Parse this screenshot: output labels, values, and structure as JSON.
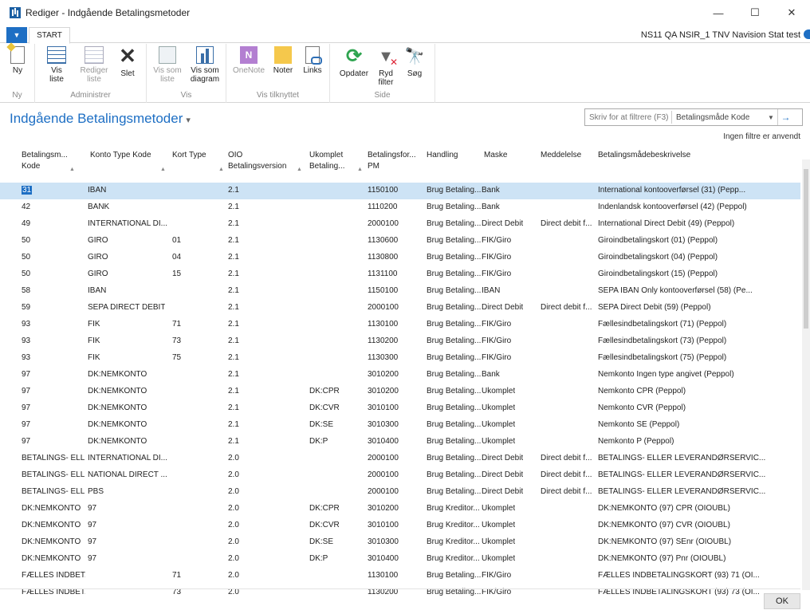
{
  "window": {
    "title": "Rediger - Indgående Betalingsmetoder",
    "buttons": {
      "minimize": "—",
      "maximize": "☐",
      "close": "✕"
    }
  },
  "ribbon": {
    "file_tab": "▼",
    "start_tab": "START",
    "company": "NS11 QA NSIR_1 TNV Navision Stat test",
    "groups": {
      "ny": {
        "label": "Ny",
        "buttons": {
          "ny": "Ny"
        }
      },
      "administrer": {
        "label": "Administrer",
        "buttons": {
          "vis_liste": "Vis liste",
          "rediger_liste": "Rediger liste",
          "slet": "Slet"
        }
      },
      "vis": {
        "label": "Vis",
        "buttons": {
          "vis_som_liste": "Vis som liste",
          "vis_som_diagram": "Vis som diagram"
        }
      },
      "vis_tilknyttet": {
        "label": "Vis tilknyttet",
        "buttons": {
          "onenote": "OneNote",
          "noter": "Noter",
          "links": "Links"
        }
      },
      "side": {
        "label": "Side",
        "buttons": {
          "opdater": "Opdater",
          "ryd_filter": "Ryd filter",
          "sog": "Søg"
        }
      }
    }
  },
  "page": {
    "title": "Indgående Betalingsmetoder",
    "title_chevron": "▾",
    "filter": {
      "placeholder": "Skriv for at filtrere (F3)",
      "field": "Betalingsmåde Kode",
      "dropdown": "▼",
      "go": "→"
    },
    "no_filters": "Ingen filtre er anvendt"
  },
  "table": {
    "headers": {
      "kode": [
        "Betalingsm...",
        "Kode"
      ],
      "konto": "Konto Type Kode",
      "kort": "Kort Type",
      "oio": [
        "OIO",
        "Betalingsversion"
      ],
      "ukomplet": [
        "Ukomplet",
        "Betaling..."
      ],
      "pm": [
        "Betalingsfor...",
        "PM"
      ],
      "handling": "Handling",
      "maske": "Maske",
      "meddelelse": "Meddelelse",
      "beskrivelse": "Betalingsmådebeskrivelse"
    },
    "rows": [
      {
        "kode": "31",
        "konto": "IBAN",
        "kort": "",
        "oio": "2.1",
        "ukomplet": "",
        "pm": "1150100",
        "handling": "Brug Betaling...",
        "maske": "Bank",
        "meddelelse": "",
        "beskrivelse": "International kontooverførsel (31) (Pepp..."
      },
      {
        "kode": "42",
        "konto": "BANK",
        "kort": "",
        "oio": "2.1",
        "ukomplet": "",
        "pm": "1110200",
        "handling": "Brug Betaling...",
        "maske": "Bank",
        "meddelelse": "",
        "beskrivelse": "Indenlandsk kontooverførsel (42) (Peppol)"
      },
      {
        "kode": "49",
        "konto": "INTERNATIONAL DI...",
        "kort": "",
        "oio": "2.1",
        "ukomplet": "",
        "pm": "2000100",
        "handling": "Brug Betaling...",
        "maske": "Direct Debit",
        "meddelelse": "Direct debit f...",
        "beskrivelse": "International Direct Debit (49) (Peppol)"
      },
      {
        "kode": "50",
        "konto": "GIRO",
        "kort": "01",
        "oio": "2.1",
        "ukomplet": "",
        "pm": "1130600",
        "handling": "Brug Betaling...",
        "maske": "FIK/Giro",
        "meddelelse": "",
        "beskrivelse": "Giroindbetalingskort (01) (Peppol)"
      },
      {
        "kode": "50",
        "konto": "GIRO",
        "kort": "04",
        "oio": "2.1",
        "ukomplet": "",
        "pm": "1130800",
        "handling": "Brug Betaling...",
        "maske": "FIK/Giro",
        "meddelelse": "",
        "beskrivelse": "Giroindbetalingskort (04) (Peppol)"
      },
      {
        "kode": "50",
        "konto": "GIRO",
        "kort": "15",
        "oio": "2.1",
        "ukomplet": "",
        "pm": "1131100",
        "handling": "Brug Betaling...",
        "maske": "FIK/Giro",
        "meddelelse": "",
        "beskrivelse": "Giroindbetalingskort (15) (Peppol)"
      },
      {
        "kode": "58",
        "konto": "IBAN",
        "kort": "",
        "oio": "2.1",
        "ukomplet": "",
        "pm": "1150100",
        "handling": "Brug Betaling...",
        "maske": "IBAN",
        "meddelelse": "",
        "beskrivelse": "SEPA IBAN Only kontooverførsel (58) (Pe..."
      },
      {
        "kode": "59",
        "konto": "SEPA DIRECT DEBIT",
        "kort": "",
        "oio": "2.1",
        "ukomplet": "",
        "pm": "2000100",
        "handling": "Brug Betaling...",
        "maske": "Direct Debit",
        "meddelelse": "Direct debit f...",
        "beskrivelse": "SEPA Direct Debit (59) (Peppol)"
      },
      {
        "kode": "93",
        "konto": "FIK",
        "kort": "71",
        "oio": "2.1",
        "ukomplet": "",
        "pm": "1130100",
        "handling": "Brug Betaling...",
        "maske": "FIK/Giro",
        "meddelelse": "",
        "beskrivelse": "Fællesindbetalingskort (71) (Peppol)"
      },
      {
        "kode": "93",
        "konto": "FIK",
        "kort": "73",
        "oio": "2.1",
        "ukomplet": "",
        "pm": "1130200",
        "handling": "Brug Betaling...",
        "maske": "FIK/Giro",
        "meddelelse": "",
        "beskrivelse": "Fællesindbetalingskort (73) (Peppol)"
      },
      {
        "kode": "93",
        "konto": "FIK",
        "kort": "75",
        "oio": "2.1",
        "ukomplet": "",
        "pm": "1130300",
        "handling": "Brug Betaling...",
        "maske": "FIK/Giro",
        "meddelelse": "",
        "beskrivelse": "Fællesindbetalingskort (75) (Peppol)"
      },
      {
        "kode": "97",
        "konto": "DK:NEMKONTO",
        "kort": "",
        "oio": "2.1",
        "ukomplet": "",
        "pm": "3010200",
        "handling": "Brug Betaling...",
        "maske": "Bank",
        "meddelelse": "",
        "beskrivelse": "Nemkonto Ingen type angivet (Peppol)"
      },
      {
        "kode": "97",
        "konto": "DK:NEMKONTO",
        "kort": "",
        "oio": "2.1",
        "ukomplet": "DK:CPR",
        "pm": "3010200",
        "handling": "Brug Betaling...",
        "maske": "Ukomplet",
        "meddelelse": "",
        "beskrivelse": "Nemkonto CPR (Peppol)"
      },
      {
        "kode": "97",
        "konto": "DK:NEMKONTO",
        "kort": "",
        "oio": "2.1",
        "ukomplet": "DK:CVR",
        "pm": "3010100",
        "handling": "Brug Betaling...",
        "maske": "Ukomplet",
        "meddelelse": "",
        "beskrivelse": "Nemkonto CVR (Peppol)"
      },
      {
        "kode": "97",
        "konto": "DK:NEMKONTO",
        "kort": "",
        "oio": "2.1",
        "ukomplet": "DK:SE",
        "pm": "3010300",
        "handling": "Brug Betaling...",
        "maske": "Ukomplet",
        "meddelelse": "",
        "beskrivelse": "Nemkonto SE (Peppol)"
      },
      {
        "kode": "97",
        "konto": "DK:NEMKONTO",
        "kort": "",
        "oio": "2.1",
        "ukomplet": "DK:P",
        "pm": "3010400",
        "handling": "Brug Betaling...",
        "maske": "Ukomplet",
        "meddelelse": "",
        "beskrivelse": "Nemkonto P (Peppol)"
      },
      {
        "kode": "BETALINGS- ELL...",
        "konto": "INTERNATIONAL DI...",
        "kort": "",
        "oio": "2.0",
        "ukomplet": "",
        "pm": "2000100",
        "handling": "Brug Betaling...",
        "maske": "Direct Debit",
        "meddelelse": "Direct debit f...",
        "beskrivelse": "BETALINGS- ELLER LEVERANDØRSERVIC..."
      },
      {
        "kode": "BETALINGS- ELL...",
        "konto": "NATIONAL DIRECT ...",
        "kort": "",
        "oio": "2.0",
        "ukomplet": "",
        "pm": "2000100",
        "handling": "Brug Betaling...",
        "maske": "Direct Debit",
        "meddelelse": "Direct debit f...",
        "beskrivelse": "BETALINGS- ELLER LEVERANDØRSERVIC..."
      },
      {
        "kode": "BETALINGS- ELL...",
        "konto": "PBS",
        "kort": "",
        "oio": "2.0",
        "ukomplet": "",
        "pm": "2000100",
        "handling": "Brug Betaling...",
        "maske": "Direct Debit",
        "meddelelse": "Direct debit f...",
        "beskrivelse": "BETALINGS- ELLER LEVERANDØRSERVIC..."
      },
      {
        "kode": "DK:NEMKONTO",
        "konto": "97",
        "kort": "",
        "oio": "2.0",
        "ukomplet": "DK:CPR",
        "pm": "3010200",
        "handling": "Brug Kreditor...",
        "maske": "Ukomplet",
        "meddelelse": "",
        "beskrivelse": "DK:NEMKONTO (97) CPR (OIOUBL)"
      },
      {
        "kode": "DK:NEMKONTO",
        "konto": "97",
        "kort": "",
        "oio": "2.0",
        "ukomplet": "DK:CVR",
        "pm": "3010100",
        "handling": "Brug Kreditor...",
        "maske": "Ukomplet",
        "meddelelse": "",
        "beskrivelse": "DK:NEMKONTO (97) CVR (OIOUBL)"
      },
      {
        "kode": "DK:NEMKONTO",
        "konto": "97",
        "kort": "",
        "oio": "2.0",
        "ukomplet": "DK:SE",
        "pm": "3010300",
        "handling": "Brug Kreditor...",
        "maske": "Ukomplet",
        "meddelelse": "",
        "beskrivelse": "DK:NEMKONTO (97) SEnr (OIOUBL)"
      },
      {
        "kode": "DK:NEMKONTO",
        "konto": "97",
        "kort": "",
        "oio": "2.0",
        "ukomplet": "DK:P",
        "pm": "3010400",
        "handling": "Brug Kreditor...",
        "maske": "Ukomplet",
        "meddelelse": "",
        "beskrivelse": "DK:NEMKONTO (97) Pnr (OIOUBL)"
      },
      {
        "kode": "FÆLLES INDBET...",
        "konto": "",
        "kort": "71",
        "oio": "2.0",
        "ukomplet": "",
        "pm": "1130100",
        "handling": "Brug Betaling...",
        "maske": "FIK/Giro",
        "meddelelse": "",
        "beskrivelse": "FÆLLES INDBETALINGSKORT (93) 71 (OI..."
      },
      {
        "kode": "FÆLLES INDBET...",
        "konto": "",
        "kort": "73",
        "oio": "2.0",
        "ukomplet": "",
        "pm": "1130200",
        "handling": "Brug Betaling...",
        "maske": "FIK/Giro",
        "meddelelse": "",
        "beskrivelse": "FÆLLES INDBETALINGSKORT (93) 73 (OI..."
      }
    ]
  },
  "footer": {
    "ok": "OK"
  },
  "colors": {
    "accent": "#1e6fc4",
    "selected_row": "#cde3f5"
  }
}
